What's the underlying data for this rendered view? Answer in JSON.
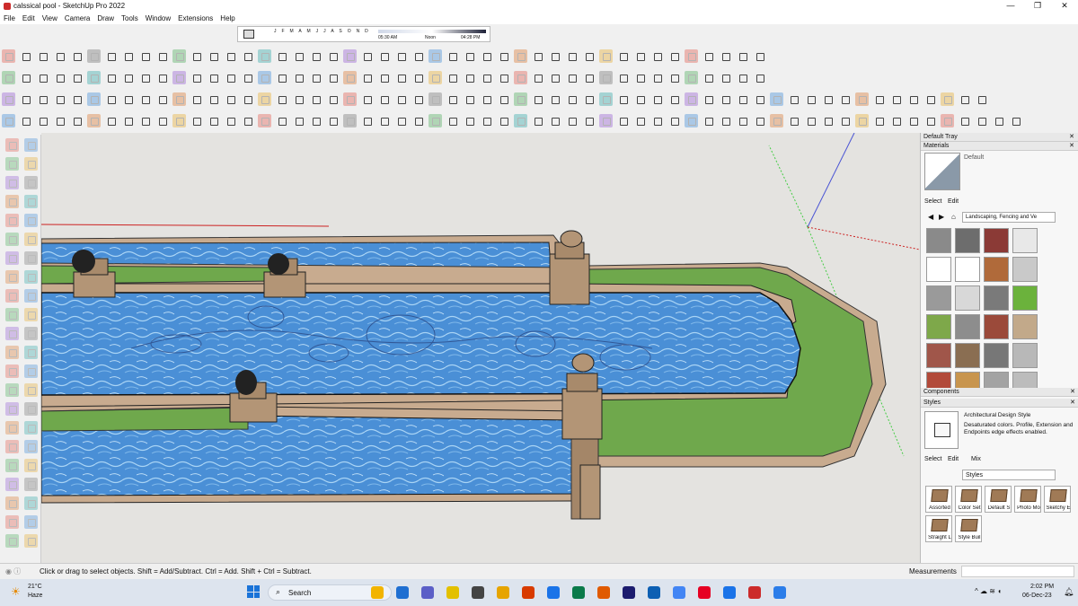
{
  "window": {
    "title": "calssical pool - SketchUp Pro 2022",
    "minimize": "—",
    "maximize": "❐",
    "close": "✕"
  },
  "menu": [
    "File",
    "Edit",
    "View",
    "Camera",
    "Draw",
    "Tools",
    "Window",
    "Extensions",
    "Help"
  ],
  "shadows": {
    "months": "J F M A M J J A S O N D",
    "time_start": "05:30 AM",
    "noon": "Noon",
    "time_end": "04:28 PM"
  },
  "tray": {
    "title": "Default Tray",
    "materials": {
      "header": "Materials",
      "current": "Default",
      "select_tab": "Select",
      "edit_tab": "Edit",
      "collection": "Landscaping, Fencing and Ve",
      "swatches": [
        "#8a8a8a",
        "#6d6d6d",
        "#8b3a36",
        "#e8e8e8",
        "#ffffff",
        "#ffffff",
        "#b06a3a",
        "#c9c9c9",
        "#9a9a9a",
        "#d8d8d8",
        "#7a7a7a",
        "#6bb23c",
        "#7ea84a",
        "#8d8d8d",
        "#9b4a3a",
        "#c2a98a",
        "#a0564a",
        "#8a6e52",
        "#777777",
        "#b8b8b8",
        "#b24a3a",
        "#c8954e",
        "#a3a3a3",
        "#bcbcbc"
      ]
    },
    "components": {
      "header": "Components"
    },
    "styles": {
      "header": "Styles",
      "name": "Architectural Design Style",
      "description": "Desaturated colors. Profile, Extension and Endpoints edge effects enabled.",
      "select_tab": "Select",
      "edit_tab": "Edit",
      "mix_tab": "Mix",
      "collection": "Styles",
      "items": [
        "Assorted",
        "Color Set",
        "Default S",
        "Photo Mo",
        "Sketchy E",
        "Straight L",
        "Style Buil"
      ]
    }
  },
  "status": {
    "text": "Click or drag to select objects. Shift = Add/Subtract. Ctrl = Add. Shift + Ctrl = Subtract.",
    "measurements": "Measurements"
  },
  "taskbar": {
    "temperature": "21°C",
    "weather": "Haze",
    "search": "Search",
    "time": "2:02 PM",
    "date": "06-Dec-23"
  },
  "colors": {
    "water": "#4a8fd6",
    "grass": "#6fa84c",
    "stone": "#c8ab8f"
  }
}
